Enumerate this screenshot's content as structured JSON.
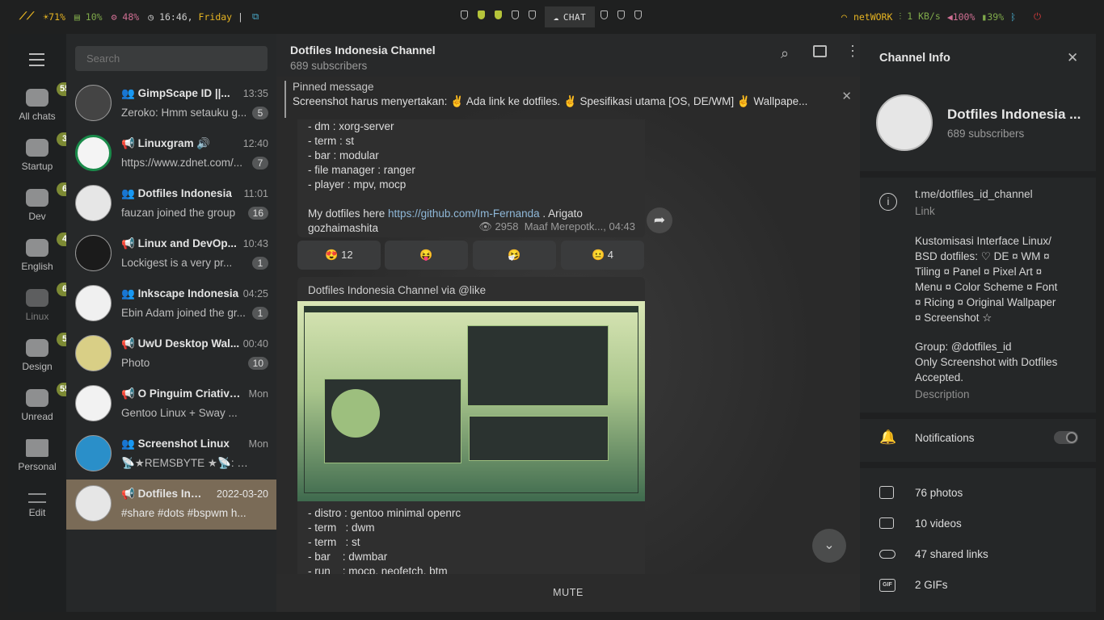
{
  "topbar": {
    "cpu": "71%",
    "mem": "10%",
    "temp": "48%",
    "time": "16:46,",
    "day": "Friday",
    "sep": "|",
    "chat": "CHAT",
    "network": "netWORK",
    "speed": "1 KB/s",
    "volume": "100%",
    "battery": "39%"
  },
  "folders": [
    {
      "label": "All chats",
      "badge": "55"
    },
    {
      "label": "Startup",
      "badge": "3"
    },
    {
      "label": "Dev",
      "badge": "6"
    },
    {
      "label": "English",
      "badge": "4"
    },
    {
      "label": "Linux",
      "badge": "6"
    },
    {
      "label": "Design",
      "badge": "5"
    },
    {
      "label": "Unread",
      "badge": "55"
    },
    {
      "label": "Personal",
      "badge": ""
    },
    {
      "label": "Edit",
      "badge": ""
    }
  ],
  "search": {
    "placeholder": "Search"
  },
  "chats": [
    {
      "title": "GimpScape ID ||...",
      "time": "13:35",
      "preview": "Zeroko: Hmm setauku g...",
      "count": "5"
    },
    {
      "title": "Linuxgram 🔊",
      "time": "12:40",
      "preview": "https://www.zdnet.com/...",
      "count": "7"
    },
    {
      "title": "Dotfiles Indonesia",
      "time": "11:01",
      "preview": "fauzan joined the group",
      "count": "16"
    },
    {
      "title": "Linux and DevOp...",
      "time": "10:43",
      "preview": "Lockigest is a very pr...",
      "count": "1"
    },
    {
      "title": "Inkscape Indonesia",
      "time": "04:25",
      "preview": "Ebin Adam joined the gr...",
      "count": "1"
    },
    {
      "title": "UwU Desktop Wal...",
      "time": "00:40",
      "preview": "Photo",
      "count": "10"
    },
    {
      "title": "O Pinguim Criativo...",
      "time": "Mon",
      "preview": "Gentoo Linux + Sway ...",
      "count": ""
    },
    {
      "title": "Screenshot Linux",
      "time": "Mon",
      "preview": "📡★REMSBYTE ★📡: Scre...",
      "count": ""
    },
    {
      "title": "Dotfiles Ind...",
      "time": "2022-03-20",
      "preview": "#share #dots #bspwm h...",
      "count": ""
    }
  ],
  "header": {
    "title": "Dotfiles Indonesia Channel",
    "subtitle": "689 subscribers"
  },
  "pinned": {
    "label": "Pinned message",
    "text": "Screenshot harus menyertakan: ✌ Ada link ke dotfiles. ✌ Spesifikasi utama [OS, DE/WM] ✌ Wallpape..."
  },
  "msg1": {
    "lines": [
      "- dm : xorg-server",
      "- term : st",
      "- bar : modular",
      "- file manager : ranger",
      "- player : mpv, mocp"
    ],
    "dot_pre": "My dotfiles here ",
    "dot_link": "https://github.com/Im-Fernanda",
    "dot_post": " . Arigato gozhaimashita",
    "views": "2958",
    "author": "Maaf Merepotk..., 04:43"
  },
  "reactions": [
    {
      "emoji": "😍",
      "count": "12"
    },
    {
      "emoji": "😝",
      "count": ""
    },
    {
      "emoji": "🤧",
      "count": ""
    },
    {
      "emoji": "😐",
      "count": "4"
    }
  ],
  "msg2": {
    "header": "Dotfiles Indonesia Channel via @like",
    "lines": [
      "- distro : gentoo minimal openrc",
      "- term   : dwm",
      "- term   : st",
      "- bar    : dwmbar",
      "- run    : mocp, neofetch, btm"
    ]
  },
  "mute": "MUTE",
  "info": {
    "title": "Channel Info",
    "name": "Dotfiles Indonesia ...",
    "subs": "689 subscribers",
    "link": "t.me/dotfiles_id_channel",
    "link_label": "Link",
    "desc": [
      "Kustomisasi Interface Linux/",
      "BSD dotfiles: ♡ DE ¤ WM ¤",
      "Tiling ¤ Panel ¤ Pixel Art ¤",
      "Menu ¤ Color Scheme ¤ Font",
      "¤ Ricing ¤ Original Wallpaper",
      "¤ Screenshot ☆"
    ],
    "group": "Group: @dotfiles_id",
    "only1": "Only Screenshot with Dotfiles",
    "only2": "Accepted.",
    "desc_label": "Description",
    "notifications": "Notifications",
    "notifications_on": false,
    "media": [
      {
        "label": "76 photos"
      },
      {
        "label": "10 videos"
      },
      {
        "label": "47 shared links"
      },
      {
        "label": "2 GIFs"
      }
    ]
  }
}
